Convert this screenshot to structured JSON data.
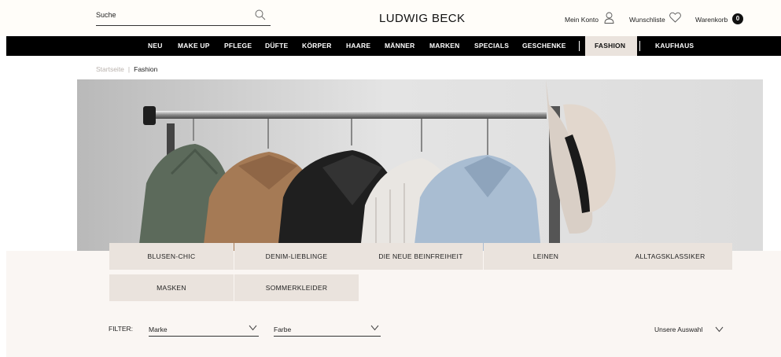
{
  "header": {
    "search_placeholder": "Suche",
    "logo": "LUDWIG BECK",
    "account_label": "Mein Konto",
    "wishlist_label": "Wunschliste",
    "cart_label": "Warenkorb",
    "cart_count": "0"
  },
  "nav": {
    "items": [
      "NEU",
      "MAKE UP",
      "PFLEGE",
      "DÜFTE",
      "KÖRPER",
      "HAARE",
      "MÄNNER",
      "MARKEN",
      "SPECIALS",
      "GESCHENKE",
      "FASHION",
      "KAUFHAUS"
    ],
    "active": "FASHION"
  },
  "breadcrumb": {
    "home": "Startseite",
    "separator": "|",
    "current": "Fashion"
  },
  "hero": {
    "description_icon": "clothes-rack-image"
  },
  "categories": [
    "BLUSEN-CHIC",
    "DENIM-LIEBLINGE",
    "DIE NEUE BEINFREIHEIT",
    "LEINEN",
    "ALLTAGSKLASSIKER",
    "MASKEN",
    "SOMMERKLEIDER"
  ],
  "filters": {
    "label": "FILTER:",
    "brand_value": "Marke",
    "color_value": "Farbe",
    "sort_value": "Unsere Auswahl"
  },
  "colors": {
    "nav_bg": "#000000",
    "active_tab": "#eae3dd",
    "tile_bg": "#eae3dd",
    "band_bg": "#faf6f3"
  }
}
